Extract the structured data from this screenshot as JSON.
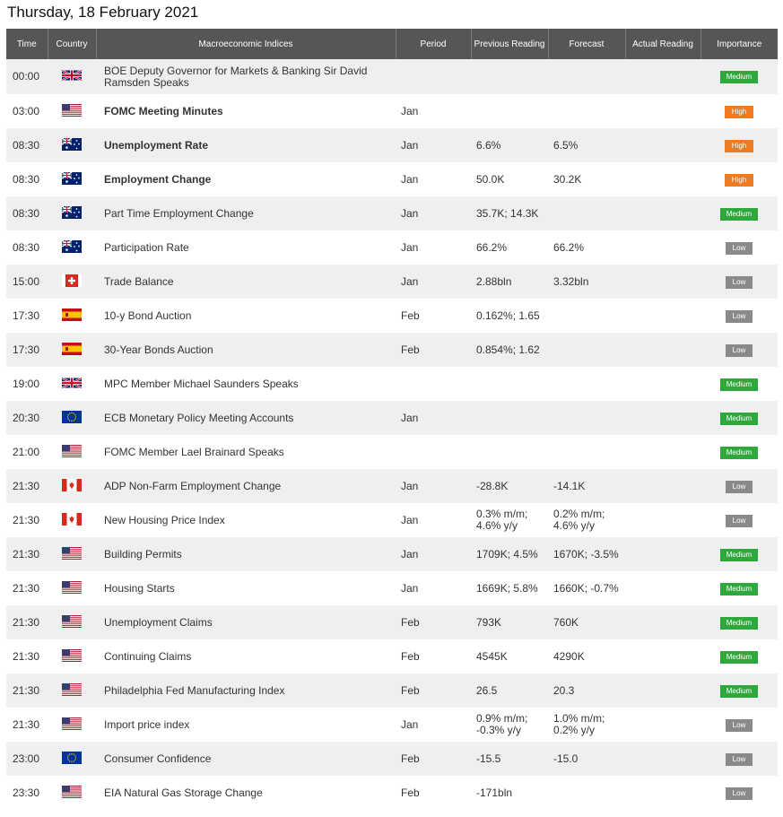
{
  "page": {
    "title": "Thursday, 18 February 2021"
  },
  "headers": {
    "time": "Time",
    "country": "Country",
    "indices": "Macroeconomic Indices",
    "period": "Period",
    "previous": "Previous Reading",
    "forecast": "Forecast",
    "actual": "Actual Reading",
    "importance": "Importance"
  },
  "colors": {
    "medium": "#2ea83c",
    "high": "#f07a22",
    "low": "#8a8a8a",
    "header": "#565656"
  },
  "rows": [
    {
      "time": "00:00",
      "flag": "uk",
      "name": "BOE Deputy Governor for Markets & Banking Sir David Ramsden Speaks",
      "bold": false,
      "period": "",
      "previous": "",
      "forecast": "",
      "actual": "",
      "importance": "Medium"
    },
    {
      "time": "03:00",
      "flag": "us",
      "name": "FOMC Meeting Minutes",
      "bold": true,
      "period": "Jan",
      "previous": "",
      "forecast": "",
      "actual": "",
      "importance": "High"
    },
    {
      "time": "08:30",
      "flag": "au",
      "name": "Unemployment Rate",
      "bold": true,
      "period": "Jan",
      "previous": "6.6%",
      "forecast": "6.5%",
      "actual": "",
      "importance": "High"
    },
    {
      "time": "08:30",
      "flag": "au",
      "name": "Employment Change",
      "bold": true,
      "period": "Jan",
      "previous": "50.0K",
      "forecast": "30.2K",
      "actual": "",
      "importance": "High"
    },
    {
      "time": "08:30",
      "flag": "au",
      "name": "Part Time Employment Change",
      "bold": false,
      "period": "Jan",
      "previous": "35.7K; 14.3K",
      "forecast": "",
      "actual": "",
      "importance": "Medium"
    },
    {
      "time": "08:30",
      "flag": "au",
      "name": "Participation Rate",
      "bold": false,
      "period": "Jan",
      "previous": "66.2%",
      "forecast": "66.2%",
      "actual": "",
      "importance": "Low"
    },
    {
      "time": "15:00",
      "flag": "ch",
      "name": "Trade Balance",
      "bold": false,
      "period": "Jan",
      "previous": "2.88bln",
      "forecast": "3.32bln",
      "actual": "",
      "importance": "Low"
    },
    {
      "time": "17:30",
      "flag": "es",
      "name": "10-y Bond Auction",
      "bold": false,
      "period": "Feb",
      "previous": "0.162%; 1.65",
      "forecast": "",
      "actual": "",
      "importance": "Low"
    },
    {
      "time": "17:30",
      "flag": "es",
      "name": "30-Year Bonds Auction",
      "bold": false,
      "period": "Feb",
      "previous": "0.854%; 1.62",
      "forecast": "",
      "actual": "",
      "importance": "Low"
    },
    {
      "time": "19:00",
      "flag": "uk",
      "name": "MPC Member Michael Saunders Speaks",
      "bold": false,
      "period": "",
      "previous": "",
      "forecast": "",
      "actual": "",
      "importance": "Medium"
    },
    {
      "time": "20:30",
      "flag": "eu",
      "name": "ECB Monetary Policy Meeting Accounts",
      "bold": false,
      "period": "Jan",
      "previous": "",
      "forecast": "",
      "actual": "",
      "importance": "Medium"
    },
    {
      "time": "21:00",
      "flag": "us",
      "name": "FOMC Member Lael Brainard Speaks",
      "bold": false,
      "period": "",
      "previous": "",
      "forecast": "",
      "actual": "",
      "importance": "Medium"
    },
    {
      "time": "21:30",
      "flag": "ca",
      "name": "ADP Non-Farm Employment Change",
      "bold": false,
      "period": "Jan",
      "previous": "-28.8K",
      "forecast": "-14.1K",
      "actual": "",
      "importance": "Low"
    },
    {
      "time": "21:30",
      "flag": "ca",
      "name": "New Housing Price Index",
      "bold": false,
      "period": "Jan",
      "previous": "0.3% m/m; 4.6% y/y",
      "forecast": "0.2% m/m; 4.6% y/y",
      "actual": "",
      "importance": "Low"
    },
    {
      "time": "21:30",
      "flag": "us",
      "name": "Building Permits",
      "bold": false,
      "period": "Jan",
      "previous": "1709K; 4.5%",
      "forecast": "1670K; -3.5%",
      "actual": "",
      "importance": "Medium"
    },
    {
      "time": "21:30",
      "flag": "us",
      "name": "Housing Starts",
      "bold": false,
      "period": "Jan",
      "previous": "1669K; 5.8%",
      "forecast": "1660K; -0.7%",
      "actual": "",
      "importance": "Medium"
    },
    {
      "time": "21:30",
      "flag": "us",
      "name": "Unemployment Claims",
      "bold": false,
      "period": "Feb",
      "previous": "793K",
      "forecast": "760K",
      "actual": "",
      "importance": "Medium"
    },
    {
      "time": "21:30",
      "flag": "us",
      "name": "Continuing Claims",
      "bold": false,
      "period": "Feb",
      "previous": "4545K",
      "forecast": "4290K",
      "actual": "",
      "importance": "Medium"
    },
    {
      "time": "21:30",
      "flag": "us",
      "name": "Philadelphia Fed Manufacturing Index",
      "bold": false,
      "period": "Feb",
      "previous": "26.5",
      "forecast": "20.3",
      "actual": "",
      "importance": "Medium"
    },
    {
      "time": "21:30",
      "flag": "us",
      "name": "Import price index",
      "bold": false,
      "period": "Jan",
      "previous": "0.9% m/m; -0.3% y/y",
      "forecast": "1.0% m/m; 0.2% y/y",
      "actual": "",
      "importance": "Low"
    },
    {
      "time": "23:00",
      "flag": "eu",
      "name": "Consumer Confidence",
      "bold": false,
      "period": "Feb",
      "previous": "-15.5",
      "forecast": "-15.0",
      "actual": "",
      "importance": "Low"
    },
    {
      "time": "23:30",
      "flag": "us",
      "name": "EIA Natural Gas Storage Change",
      "bold": false,
      "period": "Feb",
      "previous": "-171bln",
      "forecast": "",
      "actual": "",
      "importance": "Low"
    }
  ]
}
